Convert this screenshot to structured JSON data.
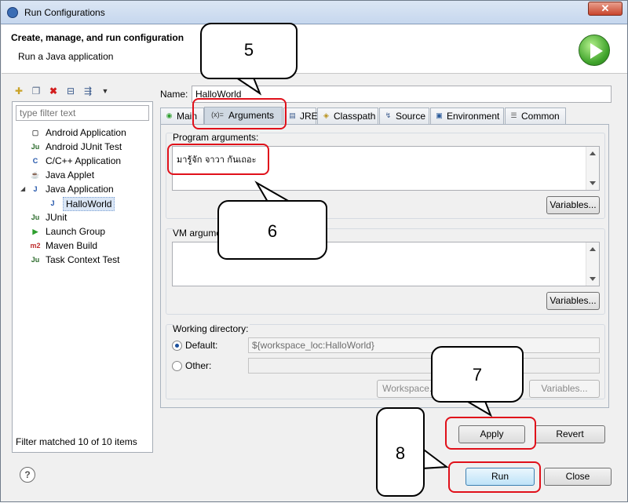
{
  "window": {
    "title": "Run Configurations",
    "close_label": "✕"
  },
  "header": {
    "title": "Create, manage, and run configuration",
    "subtitle": "Run a Java application"
  },
  "left": {
    "filter_placeholder": "type filter text",
    "tree": [
      {
        "label": "Android Application",
        "icon": "android-app-icon",
        "glyph": "▢",
        "color": "#555"
      },
      {
        "label": "Android JUnit Test",
        "icon": "junit-icon",
        "glyph": "Ju",
        "color": "#2c6b2c"
      },
      {
        "label": "C/C++ Application",
        "icon": "c-app-icon",
        "glyph": "C",
        "color": "#2255aa"
      },
      {
        "label": "Java Applet",
        "icon": "applet-icon",
        "glyph": "☕",
        "color": "#b86b17"
      },
      {
        "label": "Java Application",
        "icon": "java-app-icon",
        "glyph": "J",
        "color": "#2255aa"
      },
      {
        "label": "HalloWorld",
        "icon": "java-config-icon",
        "glyph": "J",
        "color": "#2255aa"
      },
      {
        "label": "JUnit",
        "icon": "junit-icon",
        "glyph": "Ju",
        "color": "#2c6b2c"
      },
      {
        "label": "Launch Group",
        "icon": "launch-group-icon",
        "glyph": "▶",
        "color": "#2d9e2d"
      },
      {
        "label": "Maven Build",
        "icon": "maven-icon",
        "glyph": "m2",
        "color": "#c03030"
      },
      {
        "label": "Task Context Test",
        "icon": "task-icon",
        "glyph": "Ju",
        "color": "#2c6b2c"
      }
    ],
    "status": "Filter matched 10 of 10 items"
  },
  "config": {
    "name_label": "Name:",
    "name_value": "HalloWorld",
    "tabs": [
      {
        "label": "Main",
        "icon": "main-tab-icon",
        "glyph": "◉"
      },
      {
        "label": "Arguments",
        "icon": "arguments-tab-icon",
        "glyph": "(x)="
      },
      {
        "label": "JRE",
        "icon": "jre-tab-icon",
        "glyph": "▤"
      },
      {
        "label": "Classpath",
        "icon": "classpath-tab-icon",
        "glyph": "◈"
      },
      {
        "label": "Source",
        "icon": "source-tab-icon",
        "glyph": "↯"
      },
      {
        "label": "Environment",
        "icon": "environment-tab-icon",
        "glyph": "▣"
      },
      {
        "label": "Common",
        "icon": "common-tab-icon",
        "glyph": "☰"
      }
    ],
    "program_args_label": "Program arguments:",
    "program_args_value": "มารู้จัก จาวา กันเถอะ",
    "vm_args_label": "VM argume",
    "variables_label": "Variables...",
    "working_dir_label": "Working directory:",
    "default_label": "Default:",
    "default_value": "${workspace_loc:HalloWorld}",
    "other_label": "Other:",
    "workspace_label": "Workspace...",
    "apply_label": "Apply",
    "revert_label": "Revert"
  },
  "footer": {
    "help": "?",
    "run_label": "Run",
    "close_label": "Close"
  },
  "callouts": {
    "c5": "5",
    "c6": "6",
    "c7": "7",
    "c8": "8"
  }
}
